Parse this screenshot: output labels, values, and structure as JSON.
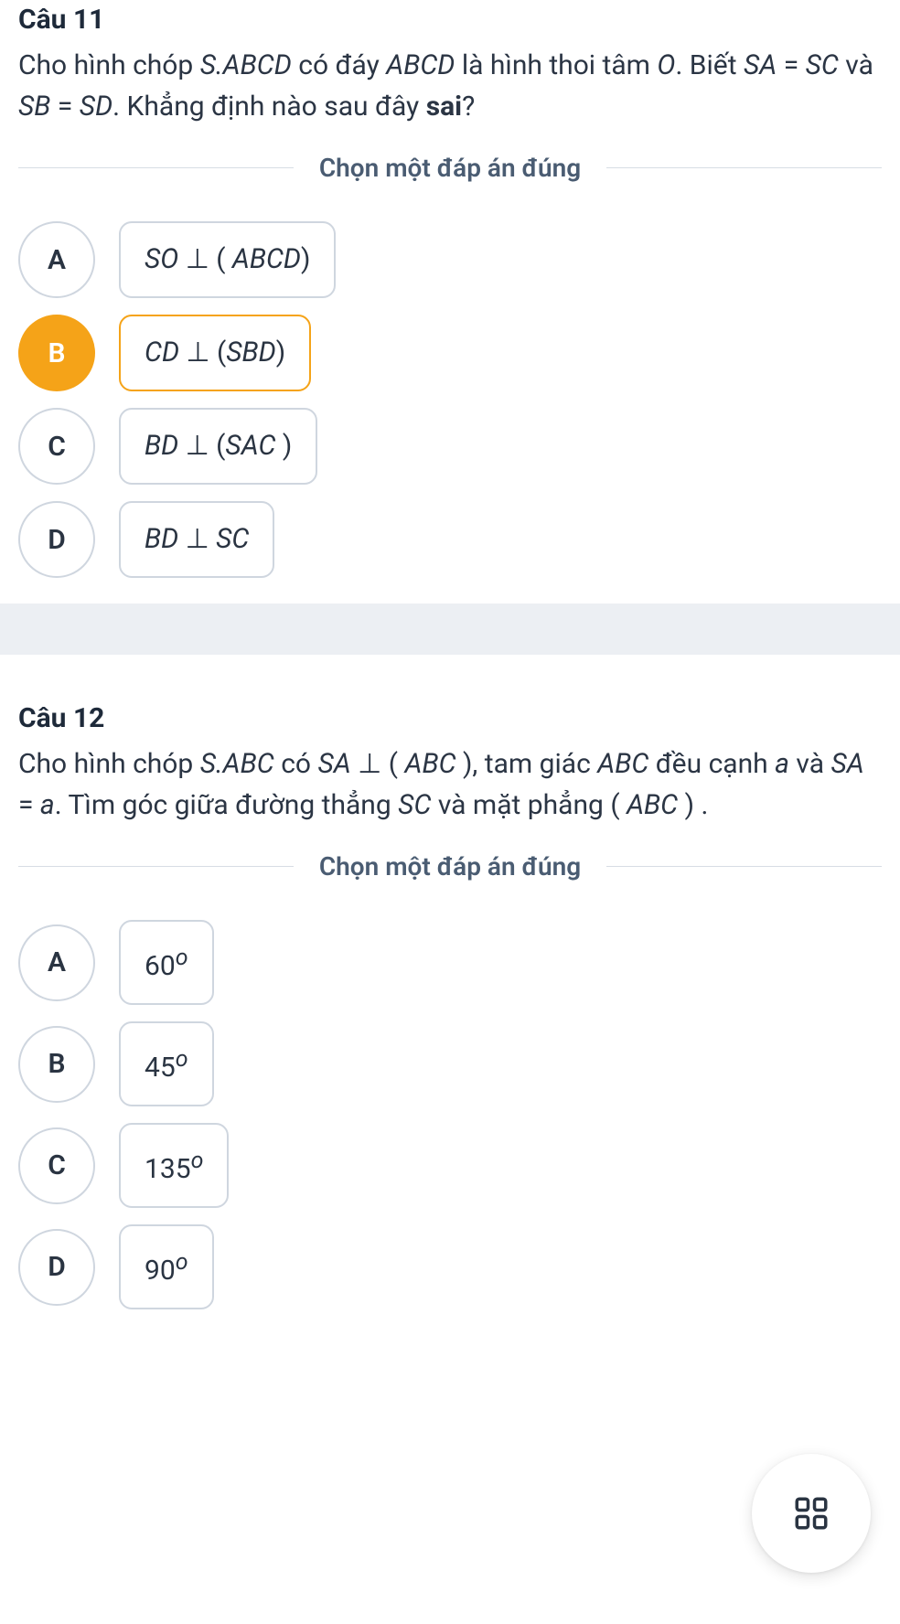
{
  "q11": {
    "title": "Câu 11",
    "body_html": "Cho hình chóp <span class='math-i'>S.ABCD</span> có đáy <span class='math-i'>ABCD</span> là hình thoi tâm <span class='math-i'>O</span>. Biết <span class='math-i'>SA</span> = <span class='math-i'>SC</span> và <span class='math-i'>SB</span> = <span class='math-i'>SD</span>. Khẳng định nào sau đây <span class='bold'>sai</span>?",
    "divider": "Chọn một đáp án đúng",
    "options": [
      {
        "letter": "A",
        "content_html": "SO <span class='perp'>⊥</span> <span class='upright'>(</span> ABCD<span class='upright'>)</span>",
        "selected": false
      },
      {
        "letter": "B",
        "content_html": "CD <span class='perp'>⊥</span> <span class='upright'>(</span>SBD<span class='upright'>)</span>",
        "selected": true
      },
      {
        "letter": "C",
        "content_html": "BD <span class='perp'>⊥</span> <span class='upright'>(</span>SAC <span class='upright'>)</span>",
        "selected": false
      },
      {
        "letter": "D",
        "content_html": "BD <span class='perp'>⊥</span> SC",
        "selected": false
      }
    ]
  },
  "q12": {
    "title": "Câu 12",
    "body_html": "Cho hình chóp <span class='math-i'>S.ABC</span> có <span class='math-i'>SA</span> ⊥ ( <span class='math-i'>ABC</span> ), tam giác <span class='math-i'>ABC</span> đều cạnh <span class='math-i'>a</span> và <span class='math-i'>SA</span> = <span class='math-i'>a</span>. Tìm góc giữa đường thẳng <span class='math-i'>SC</span> và mặt phẳng ( <span class='math-i'>ABC</span> ) .",
    "divider": "Chọn một đáp án đúng",
    "options": [
      {
        "letter": "A",
        "content_html": "<span class='upright'>60</span><sup><span class='upright' style='font-style:italic'>o</span></sup>",
        "selected": false
      },
      {
        "letter": "B",
        "content_html": "<span class='upright'>45</span><sup><span class='upright' style='font-style:italic'>o</span></sup>",
        "selected": false
      },
      {
        "letter": "C",
        "content_html": "<span class='upright'>135</span><sup><span class='upright' style='font-style:italic'>o</span></sup>",
        "selected": false
      },
      {
        "letter": "D",
        "content_html": "<span class='upright'>90</span><sup><span class='upright' style='font-style:italic'>o</span></sup>",
        "selected": false
      }
    ]
  },
  "fab_icon": "grid-icon"
}
